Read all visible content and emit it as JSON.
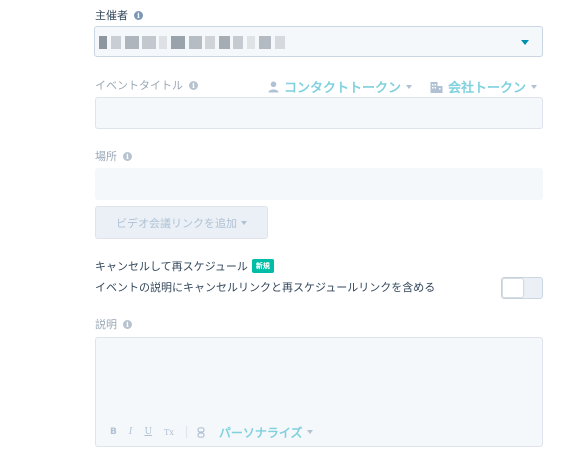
{
  "organizer": {
    "label": "主催者"
  },
  "event_title": {
    "label": "イベントタイトル",
    "value": ""
  },
  "tokens": {
    "contact": "コンタクトトークン",
    "company": "会社トークン"
  },
  "location": {
    "label": "場所",
    "value": ""
  },
  "video_button": {
    "label": "ビデオ会議リンクを追加"
  },
  "cancel_reschedule": {
    "title": "キャンセルして再スケジュール",
    "badge": "新規",
    "description": "イベントの説明にキャンセルリンクと再スケジュールリンクを含める",
    "enabled": false
  },
  "description": {
    "label": "説明",
    "value": ""
  },
  "editor_toolbar": {
    "bold": "B",
    "italic": "I",
    "underline": "U",
    "clear_format": "Tx",
    "personalize": "パーソナライズ"
  },
  "colors": {
    "accent": "#0091ae",
    "token_link": "#7fd1de",
    "badge": "#00bda5"
  }
}
